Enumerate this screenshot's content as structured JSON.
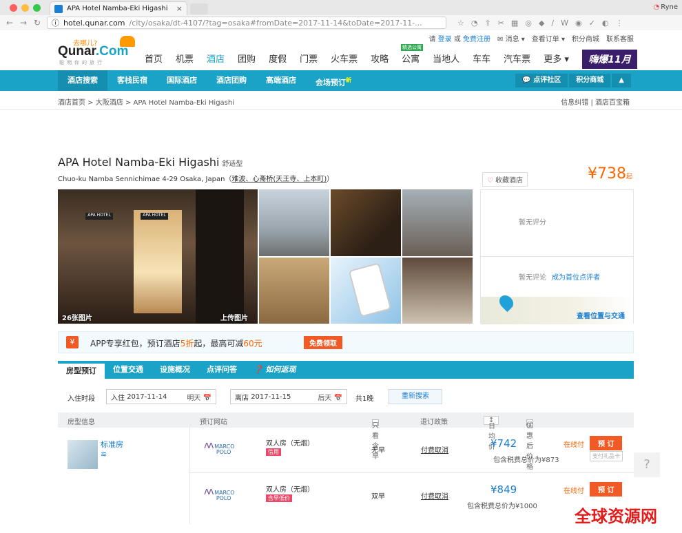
{
  "browser": {
    "tab_title": "APA Hotel Namba-Eki Higashi",
    "tab_close": "×",
    "user_name": "Ryne",
    "url_host": "hotel.qunar.com",
    "url_path": "/city/osaka/dt-4107/?tag=osaka#fromDate=2017-11-14&toDate=2017-11-...",
    "ext_icons": [
      "☆",
      "◔",
      "⇧",
      "✂",
      "▦",
      "◎",
      "◆",
      "/",
      "W",
      "◉",
      "✓",
      "◐",
      "⋮"
    ]
  },
  "site": {
    "logo_small": "去哪儿?",
    "logo_main": "Qunar",
    "logo_dot": ".Com",
    "logo_sub": "聪明你的旅行",
    "toplinks": {
      "greet": "请",
      "login": "登录",
      "or": "或",
      "register": "免费注册",
      "messages": "消息",
      "orders": "查看订单",
      "points": "积分商城",
      "service": "联系客服"
    },
    "main_nav": [
      "首页",
      "机票",
      "酒店",
      "团购",
      "度假",
      "门票",
      "火车票",
      "攻略",
      "公寓",
      "当地人",
      "车车",
      "汽车票",
      "更多"
    ],
    "gongyu_tag": "精选公寓",
    "promo": "嗨爆11月",
    "sub_nav": [
      "酒店搜索",
      "客栈民宿",
      "国际酒店",
      "酒店团购",
      "高端酒店",
      "会场预订"
    ],
    "new_tag": "新",
    "sub_nav_right": [
      "点评社区",
      "积分商城",
      "▲"
    ]
  },
  "breadcrumb": {
    "path": "酒店首页 > 大阪酒店 > APA Hotel Namba-Eki Higashi",
    "right": "信息纠错 | 酒店百宝箱"
  },
  "hotel": {
    "name": "APA Hotel Namba-Eki Higashi",
    "type": "舒适型",
    "address": "Chuo-ku Namba Sennichimae 4-29 Osaka, Japan（",
    "area": "难波、心斋桥(天王寺、上本町)",
    "address_end": "）",
    "fav_label": "收藏酒店",
    "price_symbol": "¥738",
    "price_suffix": "起",
    "photos_count": "26张图片",
    "upload_photo": "上传图片",
    "sign1": "APA HOTEL",
    "sign2": "APA HOTEL",
    "no_score": "暂无评分",
    "no_review": "暂无评论",
    "first_review": "成为首位点评者",
    "map_link": "查看位置与交通"
  },
  "app_promo": {
    "icon": "¥",
    "text1": "APP专享红包，预订酒店",
    "disc": "5折",
    "text2": "起，最高可减",
    "amount": "60元",
    "button": "免费领取"
  },
  "tabs": [
    "房型预订",
    "位置交通",
    "设施概况",
    "点评问答",
    "❓ 如何返现"
  ],
  "search": {
    "label": "入住时段",
    "checkin_label": "入住",
    "checkin": "2017-11-14",
    "checkin_day": "明天",
    "checkout_label": "离店",
    "checkout": "2017-11-15",
    "checkout_day": "后天",
    "nights": "共1晚",
    "research": "重新搜索"
  },
  "table": {
    "col_room": "房型信息",
    "col_site": "预订网站",
    "col_breakfast_filter": "只看含早",
    "col_policy": "退订政策",
    "col_avg": "日均价",
    "col_discount": "优惠后价格"
  },
  "room": {
    "name": "标准房",
    "wifi": "≋",
    "offers": [
      {
        "site_top": "MARCO",
        "site_bottom": "POLO",
        "room_type": "双人房（无烟）",
        "tag": "信用",
        "breakfast": "无早",
        "cancel": "付费取消",
        "price": "¥742",
        "total": "包含税费总价为¥873",
        "pay": "在线付",
        "book": "预 订",
        "gift": "支付礼品卡"
      },
      {
        "site_top": "MARCO",
        "site_bottom": "POLO",
        "room_type": "双人房（无烟）",
        "tag": "含早低价",
        "breakfast": "双早",
        "cancel": "付费取消",
        "price": "¥849",
        "total": "包含税费总价为¥1000",
        "pay": "在线付",
        "book": "预 订",
        "gift": ""
      }
    ]
  },
  "help": "?",
  "watermark": "全球资源网",
  "colors": {
    "teal": "#1aa3c6",
    "orange": "#f15a24",
    "link": "#1a7fd4"
  }
}
